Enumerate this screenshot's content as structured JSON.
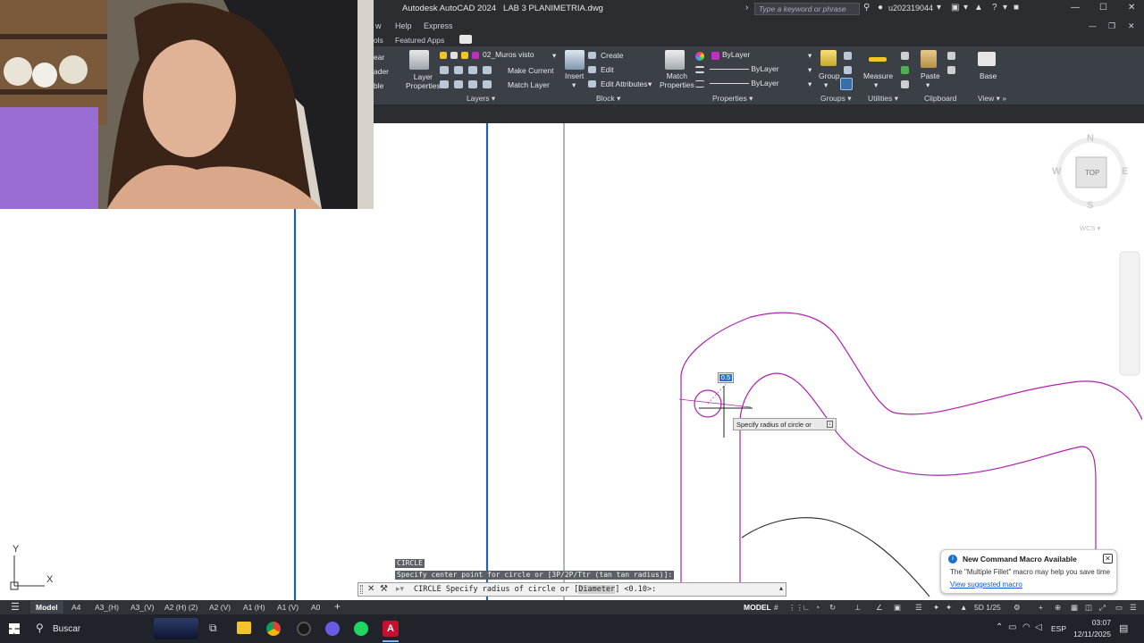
{
  "titlebar": {
    "app_title": "Autodesk AutoCAD 2024",
    "file_name": "LAB 3 PLANIMETRIA.dwg",
    "search_placeholder": "Type a keyword or phrase",
    "username": "u202319044"
  },
  "menubar": {
    "items": [
      "w",
      "Help",
      "Express"
    ]
  },
  "tabsrow": {
    "items": [
      "ols",
      "Featured Apps"
    ]
  },
  "ribbon": {
    "left_clipped": [
      "ear",
      "ader",
      "ble"
    ],
    "layers": {
      "layer_properties": "Layer\nProperties",
      "layer_dropdown": "02_Muros visto",
      "make_current": "Make Current",
      "match_layer": "Match Layer",
      "panel_label": "Layers"
    },
    "insert": {
      "label": "Insert"
    },
    "block": {
      "create": "Create",
      "edit": "Edit",
      "edit_attributes": "Edit Attributes",
      "panel_label": "Block"
    },
    "properties": {
      "match_properties": "Match\nProperties",
      "color": "ByLayer",
      "linetype": "ByLayer",
      "lineweight": "ByLayer",
      "panel_label": "Properties"
    },
    "groups": {
      "group": "Group",
      "panel_label": "Groups"
    },
    "utilities": {
      "measure": "Measure",
      "panel_label": "Utilities"
    },
    "clipboard": {
      "paste": "Paste",
      "panel_label": "Clipboard"
    },
    "view": {
      "base": "Base",
      "panel_label": "View"
    }
  },
  "viewcube": {
    "n": "N",
    "s": "S",
    "e": "E",
    "w": "W",
    "top": "TOP",
    "wcs": "WCS"
  },
  "ucs": {
    "x": "X",
    "y": "Y"
  },
  "cursor": {
    "input_value": "0.5",
    "tooltip": "Specify radius of circle or"
  },
  "commandline": {
    "history1": "CIRCLE",
    "history2": "Specify center point for circle or [3P/2P/Ttr (tan tan radius)]:",
    "prompt": "CIRCLE Specify radius of circle or [Diameter] <0.10>:",
    "prompt_cmd": "CIRCLE Specify radius of circle or [",
    "prompt_option": "Diameter",
    "prompt_tail": "] <0.10>:"
  },
  "layout_tabs": [
    "Model",
    "A4",
    "A3_(H)",
    "A3_(V)",
    "A2 (H) (2)",
    "A2 (V)",
    "A1 (H)",
    "A1 (V)",
    "A0"
  ],
  "statusbar": {
    "mode": "MODEL",
    "scale": "5D 1/25"
  },
  "notification": {
    "title": "New Command Macro Available",
    "body": "The \"Multiple Fillet\" macro may help you save time",
    "link": "View suggested macro"
  },
  "taskbar": {
    "search": "Buscar",
    "language": "ESP",
    "time": "03:07",
    "date": "12/11/2025"
  }
}
